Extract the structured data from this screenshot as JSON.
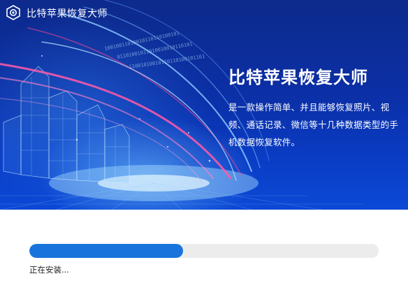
{
  "window": {
    "app_title": "比特苹果恢复大师",
    "logo_icon": "app-logo-icon"
  },
  "hero": {
    "title": "比特苹果恢复大师",
    "description": "是一款操作简单、并且能够恢复照片、视频、通话记录、微信等十几种数据类型的手机数据恢复软件。"
  },
  "install": {
    "progress_percent": 44,
    "status": "正在安装..."
  },
  "colors": {
    "progress_fill": "#1874dc",
    "progress_track": "#ececec",
    "banner_base": "#0b2fa6"
  }
}
